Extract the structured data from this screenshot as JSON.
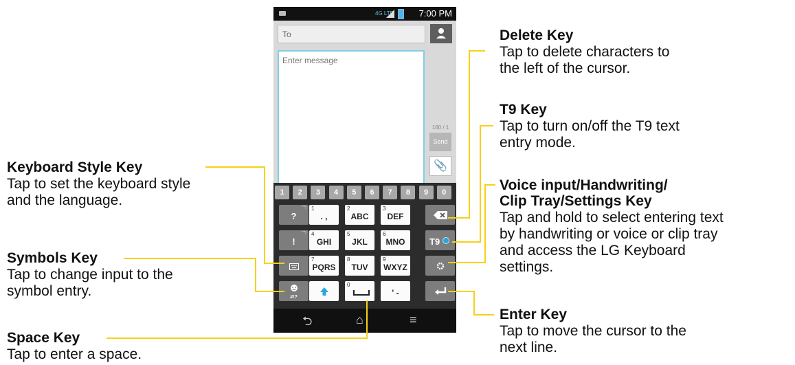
{
  "phone": {
    "status_bar": {
      "network": "4G LTE",
      "time": "7:00 PM",
      "icons": [
        "mail-notification-icon",
        "signal-icon",
        "battery-icon"
      ]
    },
    "to_placeholder": "To",
    "message_placeholder": "Enter message",
    "counter": "160 / 1",
    "send_label": "Send",
    "contact_icon": "person-icon",
    "attach_icon": "paperclip-icon",
    "keyboard": {
      "number_row": [
        "1",
        "2",
        "3",
        "4",
        "5",
        "6",
        "7",
        "8",
        "9",
        "0"
      ],
      "rows": [
        [
          {
            "sub": "",
            "label": "?",
            "corner": "\"\"!"
          },
          {
            "sub": "1",
            "label": ". ,"
          },
          {
            "sub": "2",
            "label": "ABC"
          },
          {
            "sub": "3",
            "label": "DEF"
          },
          {
            "label": "",
            "icon": "backspace-icon"
          }
        ],
        [
          {
            "sub": "",
            "label": "!",
            "corner": "\"\"!"
          },
          {
            "sub": "4",
            "label": "GHI"
          },
          {
            "sub": "5",
            "label": "JKL"
          },
          {
            "sub": "6",
            "label": "MNO"
          },
          {
            "label": "T9"
          }
        ],
        [
          {
            "label": "",
            "icon": "keyboard-style-icon"
          },
          {
            "sub": "7",
            "label": "PQRS"
          },
          {
            "sub": "8",
            "label": "TUV"
          },
          {
            "sub": "9",
            "label": "WXYZ"
          },
          {
            "label": "",
            "icon": "gear-icon"
          }
        ],
        [
          {
            "label": "#!?",
            "icon": "smiley-icon"
          },
          {
            "label": "",
            "icon": "shift-arrow-icon"
          },
          {
            "sub": "0",
            "label": "",
            "icon": "space-icon"
          },
          {
            "label": "' -"
          },
          {
            "label": "",
            "icon": "enter-icon"
          }
        ]
      ]
    },
    "nav_icons": [
      "back-icon",
      "home-icon",
      "menu-icon"
    ]
  },
  "annotations": {
    "delete": {
      "title": "Delete Key",
      "lines": [
        "Tap to delete characters to",
        "the left of the cursor."
      ]
    },
    "t9": {
      "title": "T9 Key",
      "lines": [
        "Tap to turn on/off the T9 text",
        "entry mode."
      ]
    },
    "voice": {
      "title_lines": [
        "Voice input/Handwriting/",
        "Clip Tray/Settings Key"
      ],
      "lines": [
        "Tap and hold to select entering text",
        "by handwriting or voice or clip tray",
        "and access the LG Keyboard",
        "settings."
      ]
    },
    "enter": {
      "title": "Enter Key",
      "lines": [
        "Tap to move the cursor to the",
        "next line."
      ]
    },
    "keyboard_style": {
      "title": "Keyboard Style Key",
      "lines": [
        "Tap to set the keyboard style",
        "and the  language."
      ]
    },
    "symbols": {
      "title": "Symbols Key",
      "lines": [
        "Tap to change input to the",
        "symbol entry."
      ]
    },
    "space": {
      "title": "Space Key",
      "lines": [
        "Tap to enter a space."
      ]
    }
  },
  "colors": {
    "callout_line": "#f7d117",
    "accent_blue": "#2aa6d8",
    "keyboard_bg": "#2c2c2c"
  }
}
